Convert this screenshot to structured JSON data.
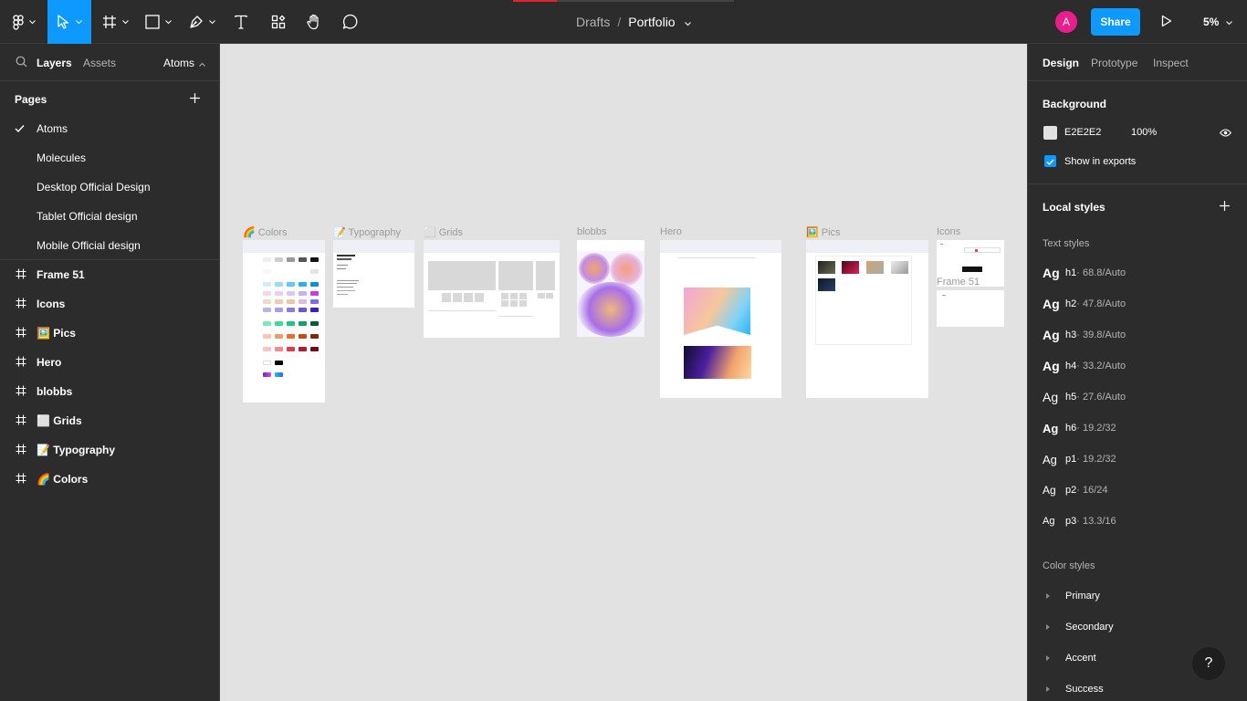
{
  "toolbar": {
    "breadcrumb_parent": "Drafts",
    "breadcrumb_separator": "/",
    "file_name": "Portfolio",
    "avatar_initial": "A",
    "share_label": "Share",
    "zoom": "5%",
    "active_tool": "move",
    "icons": [
      "figma-menu-icon",
      "move-icon",
      "frame-icon",
      "shape-icon",
      "pen-icon",
      "text-icon",
      "components-icon",
      "hand-icon",
      "comment-icon",
      "play-icon"
    ]
  },
  "left": {
    "tab_layers": "Layers",
    "tab_assets": "Assets",
    "page_selector": "Atoms",
    "pages_heading": "Pages",
    "pages": [
      {
        "label": "Atoms",
        "current": true
      },
      {
        "label": "Molecules"
      },
      {
        "label": "Desktop Official Design"
      },
      {
        "label": "Tablet Official design"
      },
      {
        "label": "Mobile Official design"
      }
    ],
    "layers": [
      {
        "label": "Frame 51"
      },
      {
        "label": "Icons"
      },
      {
        "label": "🖼️ Pics"
      },
      {
        "label": "Hero"
      },
      {
        "label": "blobbs"
      },
      {
        "label": "⬜ Grids"
      },
      {
        "label": "📝 Typography"
      },
      {
        "label": "🌈 Colors"
      }
    ]
  },
  "canvas": {
    "background": "#E2E2E2",
    "frames": {
      "colors": "🌈 Colors",
      "typography": "📝 Typography",
      "grids": "⬜ Grids",
      "blobbs": "blobbs",
      "hero": "Hero",
      "pics": "🖼️ Pics",
      "icons": "Icons",
      "frame51": "Frame 51"
    }
  },
  "right": {
    "tab_design": "Design",
    "tab_prototype": "Prototype",
    "tab_inspect": "Inspect",
    "background_heading": "Background",
    "background_hex": "E2E2E2",
    "background_opacity": "100%",
    "show_in_exports": "Show in exports",
    "local_styles_heading": "Local styles",
    "text_styles_heading": "Text styles",
    "text_styles": [
      {
        "ag": "Ag",
        "name": "h1",
        "spec": " · 68.8/Auto"
      },
      {
        "ag": "Ag",
        "name": "h2",
        "spec": " · 47.8/Auto"
      },
      {
        "ag": "Ag",
        "name": "h3",
        "spec": " · 39.8/Auto"
      },
      {
        "ag": "Ag",
        "name": "h4",
        "spec": " · 33.2/Auto"
      },
      {
        "ag": "Ag",
        "name": "h5",
        "spec": " · 27.6/Auto"
      },
      {
        "ag": "Ag",
        "name": "h6",
        "spec": " · 19.2/32"
      },
      {
        "ag": "Ag",
        "name": "p1",
        "spec": " · 19.2/32"
      },
      {
        "ag": "Ag",
        "name": "p2",
        "spec": " · 16/24"
      },
      {
        "ag": "Ag",
        "name": "p3",
        "spec": " · 13.3/16"
      }
    ],
    "color_styles_heading": "Color styles",
    "color_styles": [
      "Primary",
      "Secondary",
      "Accent",
      "Success"
    ],
    "help": "?"
  },
  "colors": {
    "accent": "#0D99FF",
    "avatar": "#E91E8C"
  }
}
